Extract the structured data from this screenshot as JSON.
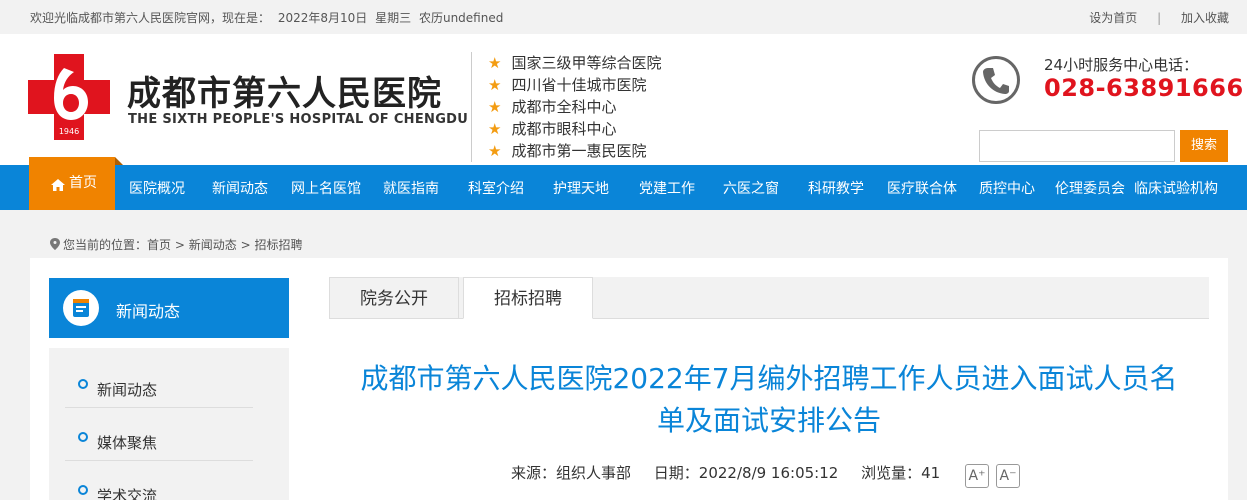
{
  "topbar": {
    "welcome": "欢迎光临成都市第六人民医院官网，现在是：",
    "date": "2022年8月10日",
    "weekday": "星期三",
    "lunar": "农历undefined",
    "set_home": "设为首页",
    "separator": "|",
    "favorite": "加入收藏"
  },
  "header": {
    "logo_year": "1946",
    "cn_name": "成都市第六人民医院",
    "en_name": "THE SIXTH PEOPLE'S HOSPITAL OF CHENGDU",
    "honors": [
      "国家三级甲等综合医院",
      "四川省十佳城市医院",
      "成都市全科中心",
      "成都市眼科中心",
      "成都市第一惠民医院"
    ],
    "star_glyph": "★",
    "phone_label": "24小时服务中心电话：",
    "phone_number": "028-63891666",
    "search_placeholder": "",
    "search_button": "搜索"
  },
  "nav": {
    "home": "首页",
    "items": [
      "医院概况",
      "新闻动态",
      "网上名医馆",
      "就医指南",
      "科室介绍",
      "护理天地",
      "党建工作",
      "六医之窗",
      "科研教学",
      "医疗联合体",
      "质控中心",
      "伦理委员会",
      "临床试验机构"
    ]
  },
  "breadcrumb": {
    "prefix": "您当前的位置：",
    "items": [
      "首页",
      "新闻动态",
      "招标招聘"
    ],
    "separator": ">"
  },
  "sidebar": {
    "title": "新闻动态",
    "items": [
      "新闻动态",
      "媒体聚焦",
      "学术交流"
    ]
  },
  "tabs": [
    {
      "label": "院务公开",
      "active": false
    },
    {
      "label": "招标招聘",
      "active": true
    }
  ],
  "article": {
    "title_line1": "成都市第六人民医院2022年7月编外招聘工作人员进入面试人员名",
    "title_line2": "单及面试安排公告",
    "source": "来源：组织人事部",
    "date": "日期：2022/8/9 16:05:12",
    "views": "浏览量：41",
    "font_larger": "A⁺",
    "font_smaller": "A⁻"
  },
  "colors": {
    "primary": "#0a85d8",
    "accent": "#f08300",
    "logo_red": "#e0141e",
    "star": "#f39c12"
  }
}
